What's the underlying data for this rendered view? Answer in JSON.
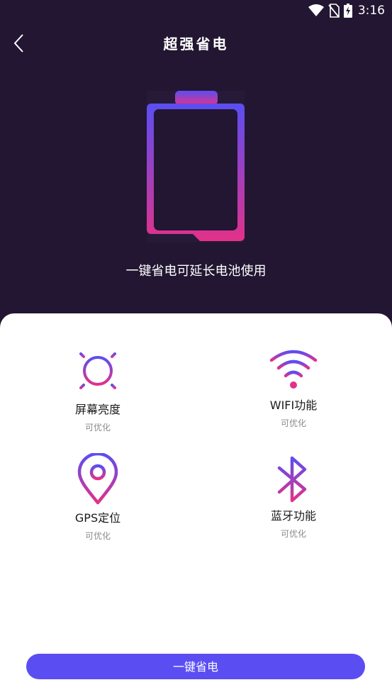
{
  "status_bar": {
    "time": "3:16",
    "icons": [
      "wifi-icon",
      "no-sim-icon",
      "battery-charging-icon"
    ]
  },
  "header": {
    "title": "超强省电",
    "back_icon": "chevron-left-icon"
  },
  "hero": {
    "subtitle": "一键省电可延长电池使用",
    "gradient_top": "#5a4ef2",
    "gradient_bottom": "#e2318a"
  },
  "features": [
    {
      "label": "屏幕亮度",
      "status": "可优化",
      "icon": "sun-icon"
    },
    {
      "label": "WIFI功能",
      "status": "可优化",
      "icon": "wifi-icon"
    },
    {
      "label": "GPS定位",
      "status": "可优化",
      "icon": "location-pin-icon"
    },
    {
      "label": "蓝牙功能",
      "status": "可优化",
      "icon": "bluetooth-icon"
    }
  ],
  "action": {
    "label": "一键省电",
    "color": "#5a4ef2"
  },
  "colors": {
    "background": "#221632",
    "card": "#ffffff"
  }
}
